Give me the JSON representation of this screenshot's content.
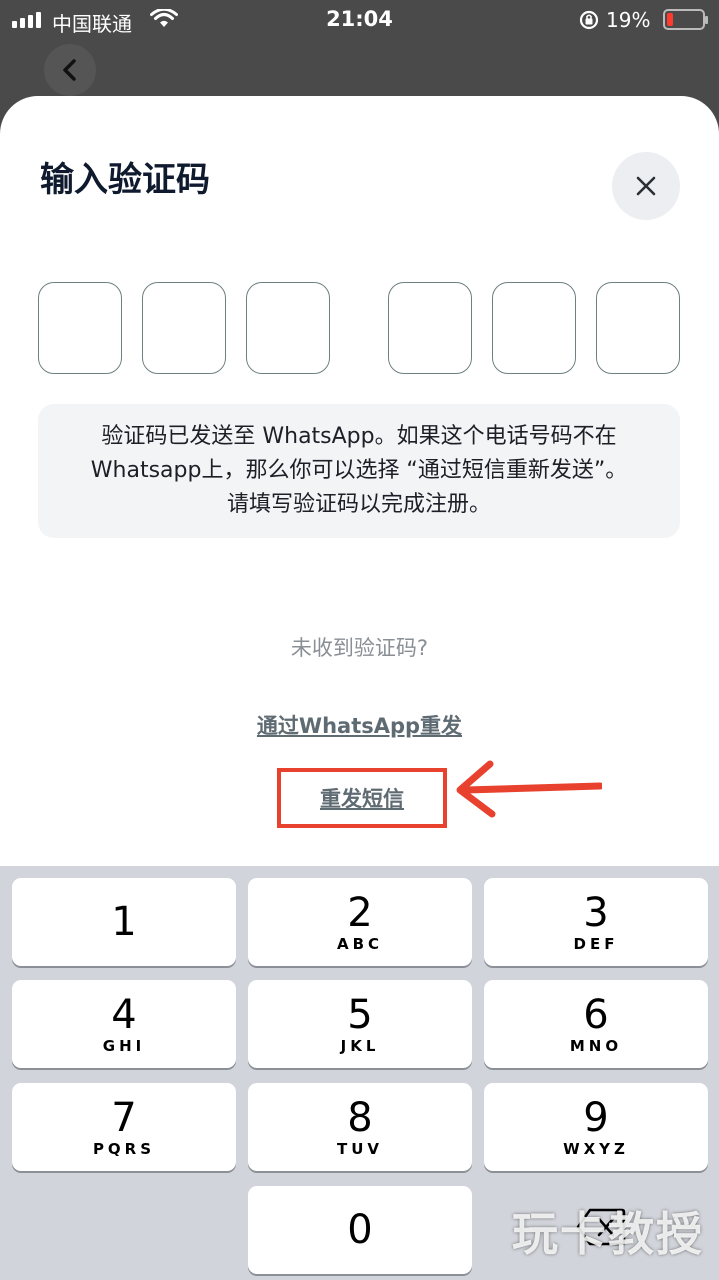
{
  "status_bar": {
    "carrier": "中国联通",
    "time": "21:04",
    "battery": "19%",
    "battery_level": 0.19,
    "icons": [
      "signal-icon",
      "wifi-icon",
      "rotation-lock-icon",
      "battery-icon"
    ]
  },
  "header": {
    "back_icon": "chevron-left-icon"
  },
  "sheet": {
    "title": "输入验证码",
    "close_icon": "close-icon",
    "code_boxes": [
      "",
      "",
      "",
      "",
      "",
      ""
    ],
    "info": {
      "line1": "验证码已发送至 WhatsApp。如果这个电话号码不在",
      "line2": "Whatsapp上，那么你可以选择 “通过短信重新发送”。",
      "line3": "请填写验证码以完成注册。"
    },
    "no_code_text": "未收到验证码?",
    "resend_whatsapp": "通过WhatsApp重发",
    "resend_sms": "重发短信",
    "highlight_color": "#e8422e"
  },
  "keypad": {
    "keys": [
      {
        "num": "1",
        "letters": ""
      },
      {
        "num": "2",
        "letters": "ABC"
      },
      {
        "num": "3",
        "letters": "DEF"
      },
      {
        "num": "4",
        "letters": "GHI"
      },
      {
        "num": "5",
        "letters": "JKL"
      },
      {
        "num": "6",
        "letters": "MNO"
      },
      {
        "num": "7",
        "letters": "PQRS"
      },
      {
        "num": "8",
        "letters": "TUV"
      },
      {
        "num": "9",
        "letters": "WXYZ"
      },
      {
        "num": "0",
        "letters": ""
      }
    ],
    "backspace_icon": "backspace-icon"
  },
  "watermark": "玩卡教授"
}
